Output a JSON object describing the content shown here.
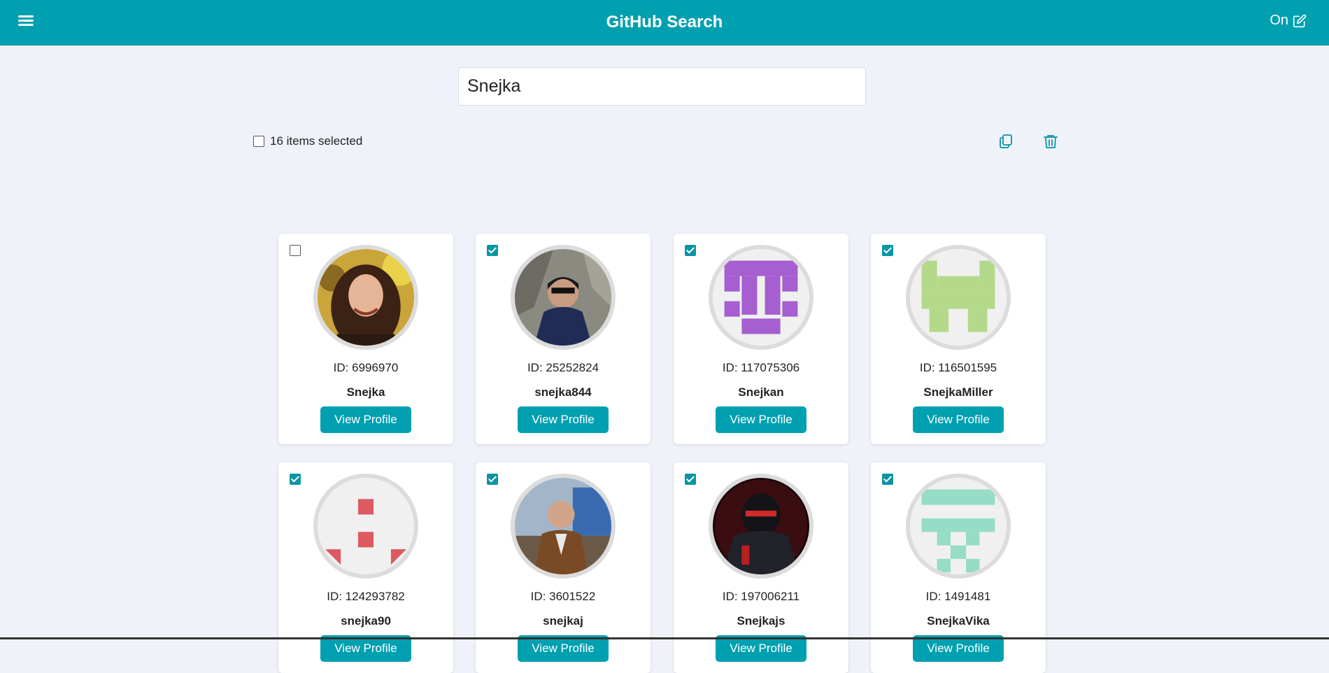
{
  "header": {
    "title": "GitHub Search",
    "mode_label": "On",
    "bg_color": "#00a0b0"
  },
  "search": {
    "value": "Snejka"
  },
  "selection": {
    "count_label": "16 items selected",
    "all_checked": false
  },
  "actions": {
    "copy_icon": "copy-icon",
    "delete_icon": "trash-icon"
  },
  "cards": [
    {
      "id_label": "ID: 6996970",
      "username": "Snejka",
      "checked": false,
      "avatar": "photo-woman",
      "button": "View Profile"
    },
    {
      "id_label": "ID: 25252824",
      "username": "snejka844",
      "checked": true,
      "avatar": "photo-man-rocks",
      "button": "View Profile"
    },
    {
      "id_label": "ID: 117075306",
      "username": "Snejkan",
      "checked": true,
      "avatar": "identicon-purple",
      "button": "View Profile"
    },
    {
      "id_label": "ID: 116501595",
      "username": "SnejkaMiller",
      "checked": true,
      "avatar": "identicon-green",
      "button": "View Profile"
    },
    {
      "id_label": "ID: 124293782",
      "username": "snejka90",
      "checked": true,
      "avatar": "identicon-red",
      "button": "View Profile"
    },
    {
      "id_label": "ID: 3601522",
      "username": "snejkaj",
      "checked": true,
      "avatar": "photo-man-suit",
      "button": "View Profile"
    },
    {
      "id_label": "ID: 197006211",
      "username": "Snejkajs",
      "checked": true,
      "avatar": "photo-ninja",
      "button": "View Profile"
    },
    {
      "id_label": "ID: 1491481",
      "username": "SnejkaVika",
      "checked": true,
      "avatar": "identicon-teal",
      "button": "View Profile"
    }
  ]
}
